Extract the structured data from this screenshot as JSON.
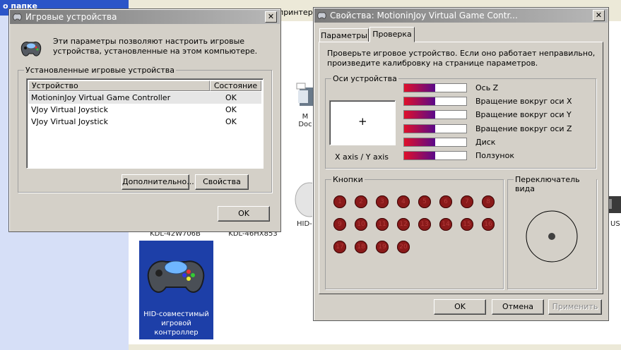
{
  "background": {
    "left_header": "о папке",
    "toolbar_text": "принтера",
    "labels": {
      "device1": "KDL-42W706B",
      "device2": "KDL-46HX853",
      "device3": "HID-",
      "device4": "M Doc",
      "device5": "US"
    },
    "selected_device": "HID-совместимый игровой контроллер"
  },
  "game_controllers": {
    "title": "Игровые устройства",
    "close_label": "✕",
    "description": "Эти параметры позволяют настроить игровые устройства, установленные на этом компьютере.",
    "group_label": "Установленные игровые устройства",
    "columns": [
      "Устройство",
      "Состояние"
    ],
    "rows": [
      {
        "device": "MotioninJoy Virtual Game Controller",
        "status": "OK"
      },
      {
        "device": "VJoy Virtual Joystick",
        "status": "OK"
      },
      {
        "device": "VJoy Virtual Joystick",
        "status": "OK"
      }
    ],
    "advanced_button": "Дополнительно...",
    "properties_button": "Свойства",
    "ok_button": "OK"
  },
  "properties": {
    "title": "Свойства: MotioninJoy Virtual Game Contr...",
    "close_label": "✕",
    "tabs": [
      "Параметры",
      "Проверка"
    ],
    "active_tab": 1,
    "description": "Проверьте игровое устройство. Если оно работает неправильно, произведите калибровку на странице параметров.",
    "axes_group_label": "Оси устройства",
    "xy_cross": "+",
    "xy_caption": "X axis / Y axis",
    "axes": [
      {
        "label": "Ось Z",
        "value": 0.5
      },
      {
        "label": "Вращение вокруг оси X",
        "value": 0.5
      },
      {
        "label": "Вращение вокруг оси Y",
        "value": 0.5
      },
      {
        "label": "Вращение вокруг оси Z",
        "value": 0.5
      },
      {
        "label": "Диск",
        "value": 0.5
      },
      {
        "label": "Ползунок",
        "value": 0.5
      }
    ],
    "buttons_group_label": "Кнопки",
    "buttons": [
      "1",
      "2",
      "3",
      "4",
      "5",
      "6",
      "7",
      "8",
      "9",
      "10",
      "11",
      "12",
      "13",
      "14",
      "15",
      "16",
      "17",
      "18",
      "19",
      "20"
    ],
    "pov_group_label": "Переключатель вида",
    "ok_button": "OK",
    "cancel_button": "Отмена",
    "apply_button": "Применить",
    "colors": {
      "bar_start": "#e0102a",
      "bar_end": "#5a0a8a",
      "button_fill": "#8a1a1a"
    }
  }
}
